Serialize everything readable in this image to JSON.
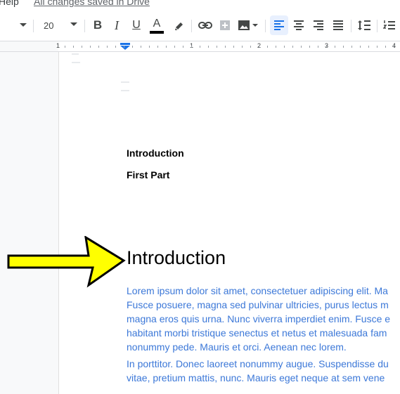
{
  "menubar": {
    "help": "Help",
    "saved": "All changes saved in Drive"
  },
  "toolbar": {
    "font_size": "20",
    "bold": "B",
    "italic": "I",
    "underline": "U",
    "text_color_letter": "A",
    "text_color": "#000000",
    "icons": [
      "chevron-down-icon",
      "bold-icon",
      "italic-icon",
      "underline-icon",
      "text-color-icon",
      "highlight-icon",
      "link-icon",
      "comment-icon",
      "image-icon",
      "align-left-icon",
      "align-center-icon",
      "align-right-icon",
      "justify-icon",
      "line-spacing-icon",
      "numbered-list-icon"
    ]
  },
  "ruler": {
    "numbers": [
      "1",
      "1",
      "2",
      "3",
      "4"
    ]
  },
  "document": {
    "toc": [
      "Introduction",
      "First Part"
    ],
    "heading": "Introduction",
    "paragraph1": [
      "Lorem ipsum dolor sit amet, consectetuer adipiscing elit. Ma",
      "Fusce posuere, magna sed pulvinar ultricies, purus lectus m",
      "magna eros quis urna. Nunc viverra imperdiet enim. Fusce e",
      "habitant morbi tristique senectus et netus et malesuada fam",
      "nonummy pede. Mauris et orci. Aenean nec lorem."
    ],
    "paragraph2": [
      "In porttitor. Donec laoreet nonummy augue. Suspendisse du",
      "vitae, pretium mattis, nunc. Mauris eget neque at sem vene"
    ],
    "body_color": "#3c78d8"
  },
  "annotation": {
    "arrow_color": "#ffff00"
  }
}
